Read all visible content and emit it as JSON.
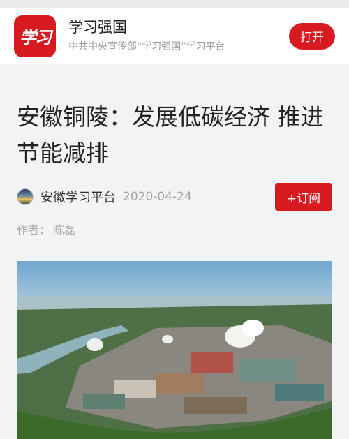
{
  "banner": {
    "logo_text": "学习",
    "app_name": "学习强国",
    "app_desc": "中共中央宣传部“学习强国”学习平台",
    "open_label": "打开"
  },
  "article": {
    "title": "安徽铜陵：发展低碳经济 推进节能减排",
    "source": "安徽学习平台",
    "date": "2020-04-24",
    "subscribe_label": "+订阅",
    "author_label": "作者：",
    "author": "陈磊"
  },
  "photo": {
    "subject": "aerial-industrial-park"
  },
  "colors": {
    "brand_red": "#d71a1f",
    "page_bg": "#f2f3f5",
    "muted_text": "#a3a3a3"
  }
}
